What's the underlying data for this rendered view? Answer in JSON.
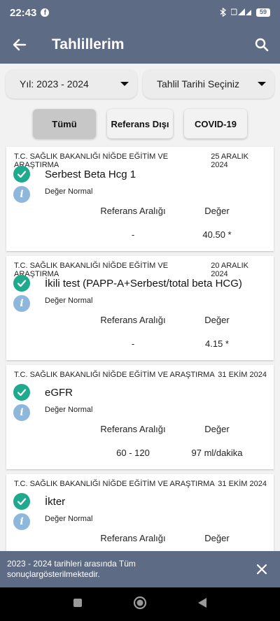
{
  "status_bar": {
    "time": "22:43",
    "battery": "59"
  },
  "app_bar": {
    "title": "Tahlillerim"
  },
  "filters": {
    "year": "Yıl: 2023 - 2024",
    "date": "Tahlil Tarihi Seçiniz"
  },
  "chips": [
    "Tümü",
    "Referans Dışı",
    "COVID-19"
  ],
  "results_header": {
    "ref_label": "Referans Aralığı",
    "value_label": "Değer"
  },
  "results": [
    {
      "institution": "T.C. SAĞLIK BAKANLIĞI NİĞDE EĞİTİM VE ARAŞTIRMA",
      "date": "25 ARALIK 2024",
      "test": "Serbest Beta Hcg 1",
      "status": "Değer Normal",
      "ref": "-",
      "value": "40.50 *"
    },
    {
      "institution": "T.C. SAĞLIK BAKANLIĞI NİĞDE EĞİTİM VE ARAŞTIRMA",
      "date": "20 ARALIK 2024",
      "test": "İkili test (PAPP-A+Serbest/total beta HCG)",
      "status": "Değer Normal",
      "ref": "-",
      "value": "4.15 *"
    },
    {
      "institution": "T.C. SAĞLIK BAKANLIĞI NİĞDE EĞİTİM VE ARAŞTIRMA",
      "date": "31 EKİM 2024",
      "test": "eGFR",
      "status": "Değer Normal",
      "ref": "60 - 120",
      "value": "97 ml/dakika"
    },
    {
      "institution": "T.C. SAĞLIK BAKANLIĞI NİĞDE EĞİTİM VE ARAŞTIRMA",
      "date": "31 EKİM 2024",
      "test": "İkter",
      "status": "Değer Normal",
      "ref": "",
      "value": ""
    }
  ],
  "snackbar": {
    "message": "2023 - 2024 tarihleri arasında Tüm sonuçlargösterilmektedir."
  },
  "colors": {
    "primary": "#5d6b84",
    "check": "#1faa8e",
    "info": "#8fb7dc"
  }
}
